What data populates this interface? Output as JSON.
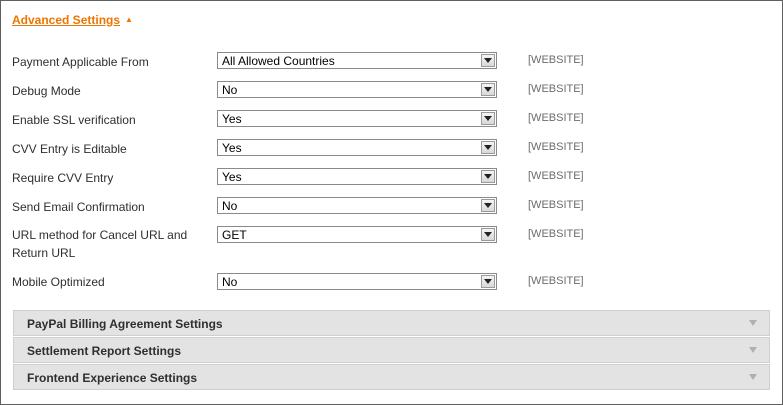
{
  "section": {
    "title": "Advanced Settings",
    "arrow": "▲"
  },
  "fields": [
    {
      "label": "Payment Applicable From",
      "value": "All Allowed Countries",
      "scope": "[WEBSITE]"
    },
    {
      "label": "Debug Mode",
      "value": "No",
      "scope": "[WEBSITE]"
    },
    {
      "label": "Enable SSL verification",
      "value": "Yes",
      "scope": "[WEBSITE]"
    },
    {
      "label": "CVV Entry is Editable",
      "value": "Yes",
      "scope": "[WEBSITE]"
    },
    {
      "label": "Require CVV Entry",
      "value": "Yes",
      "scope": "[WEBSITE]"
    },
    {
      "label": "Send Email Confirmation",
      "value": "No",
      "scope": "[WEBSITE]"
    },
    {
      "label": "URL method for Cancel URL and Return URL",
      "value": "GET",
      "scope": "[WEBSITE]"
    },
    {
      "label": "Mobile Optimized",
      "value": "No",
      "scope": "[WEBSITE]"
    }
  ],
  "groups": [
    {
      "title": "PayPal Billing Agreement Settings"
    },
    {
      "title": "Settlement Report Settings"
    },
    {
      "title": "Frontend Experience Settings"
    }
  ],
  "colors": {
    "accent": "#ea7601",
    "scope_text": "#6c6c6c",
    "group_bg": "#e3e3e3"
  }
}
